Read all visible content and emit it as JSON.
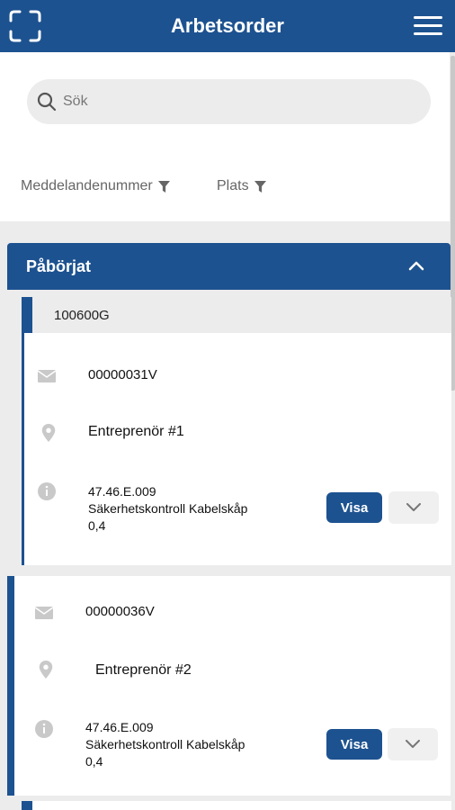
{
  "header": {
    "title": "Arbetsorder"
  },
  "search": {
    "placeholder": "Sök"
  },
  "filters": [
    {
      "label": "Meddelandenummer"
    },
    {
      "label": "Plats"
    }
  ],
  "section": {
    "title": "Påbörjat"
  },
  "group": {
    "label": "100600G"
  },
  "cards": [
    {
      "message_number": "00000031V",
      "location": "Entreprenör #1",
      "detail_code": "47.46.E.009",
      "detail_name": "Säkerhetskontroll Kabelskåp",
      "detail_value": "0,4",
      "view_label": "Visa"
    },
    {
      "message_number": "00000036V",
      "location": "Entreprenör #2",
      "detail_code": "47.46.E.009",
      "detail_name": "Säkerhetskontroll Kabelskåp",
      "detail_value": "0,4",
      "view_label": "Visa"
    }
  ],
  "colors": {
    "primary": "#1d5290",
    "background": "#ececec",
    "icon": "#c9c9c9"
  }
}
